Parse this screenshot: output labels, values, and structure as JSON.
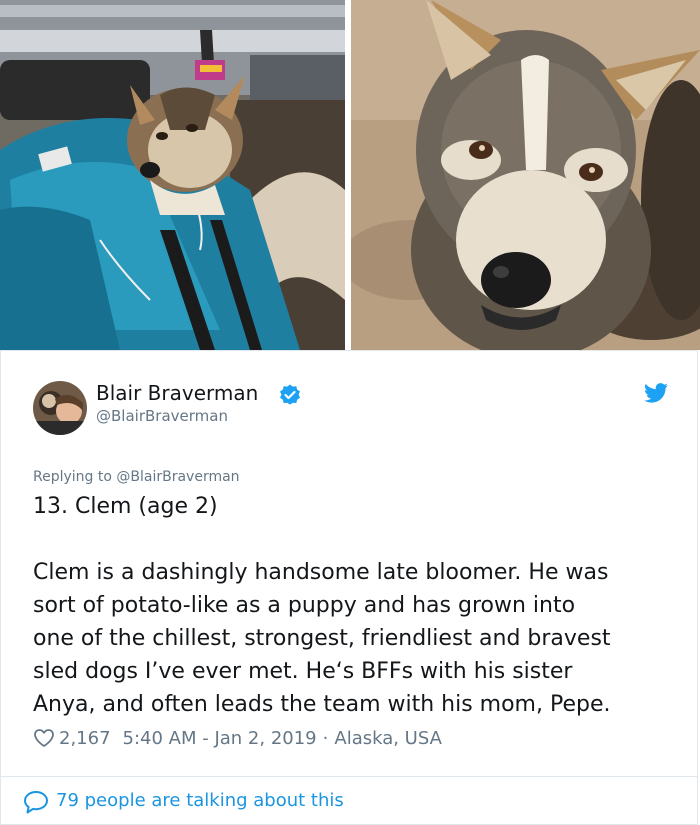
{
  "images": {
    "left_icon": "dog-in-blue-sled-bag-photo",
    "right_icon": "dog-close-up-photo"
  },
  "tweet": {
    "author_name": "Blair Braverman",
    "author_handle": "@BlairBraverman",
    "verified_icon": "verified-badge-icon",
    "bird_icon": "twitter-bird-icon",
    "reply_prefix": "Replying to ",
    "reply_handle": "@BlairBraverman",
    "title": "13. Clem (age 2)",
    "body_lines": [
      "Clem is a dashingly handsome late bloomer. He was",
      "sort of potato-like as a puppy and has grown into",
      "one of the chillest, strongest, friendliest and bravest",
      "sled dogs I’ve ever met. He‘s BFFs with his sister",
      "Anya, and often leads the team with his mom, Pepe."
    ],
    "likes": "2,167",
    "timestamp": "5:40 AM - Jan 2, 2019",
    "separator": "·",
    "location": "Alaska, USA",
    "talking": "79 people are talking about this"
  },
  "colors": {
    "accent": "#1da1f2",
    "link": "#1b95e0",
    "secondary_text": "#657786",
    "primary_text": "#14171a"
  }
}
